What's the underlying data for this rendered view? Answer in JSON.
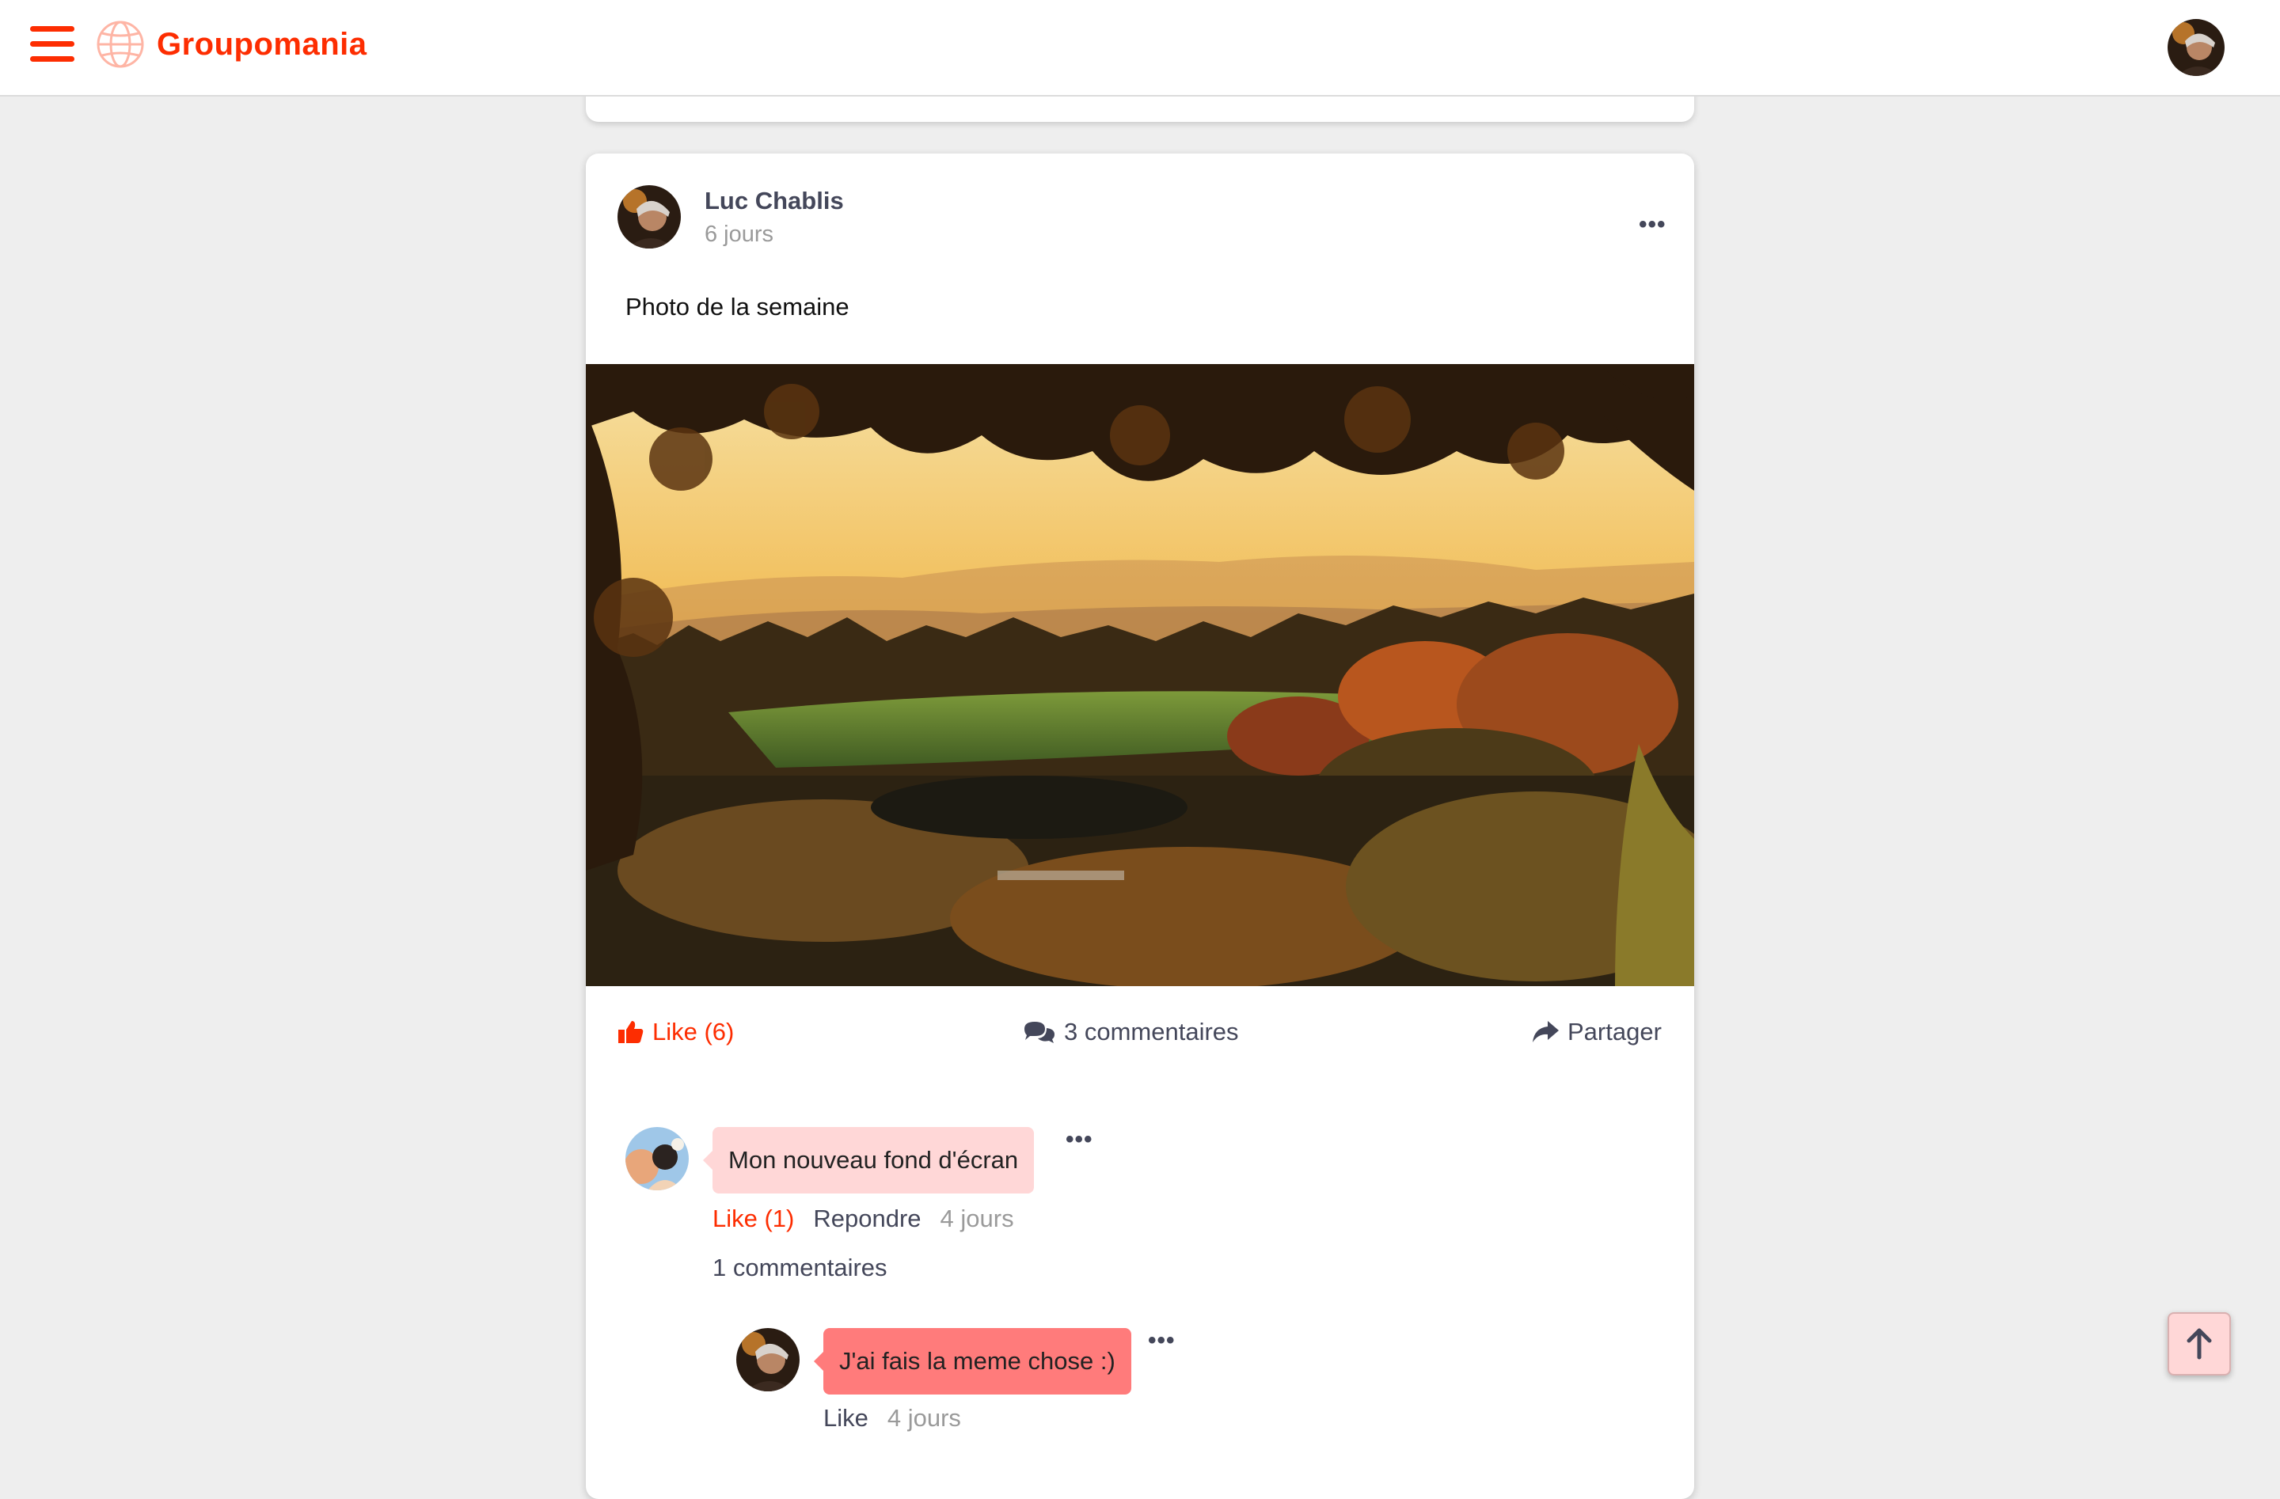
{
  "app": {
    "name": "Groupomania"
  },
  "header": {
    "menu_icon": "hamburger-menu-icon",
    "logo_icon": "globe-icon",
    "avatar": "user-avatar"
  },
  "post": {
    "author": "Luc Chablis",
    "time": "6 jours",
    "text": "Photo de la semaine",
    "image": "autumn-landscape-sunset-photo",
    "actions": {
      "like": "Like (6)",
      "comments": "3 commentaires",
      "share": "Partager"
    }
  },
  "comments": [
    {
      "text": "Mon nouveau fond d'écran",
      "like": "Like (1)",
      "reply": "Repondre",
      "time": "4 jours",
      "sub_count": "1 commentaires",
      "replies": [
        {
          "text": "J'ai fais la meme chose :)",
          "like": "Like",
          "time": "4 jours"
        }
      ]
    }
  ],
  "colors": {
    "brand": "#fd2d01",
    "bubble_light": "#ffd7d7",
    "bubble_dark": "#ff7b7b",
    "text": "#44475a",
    "muted": "#9a9a9a"
  }
}
